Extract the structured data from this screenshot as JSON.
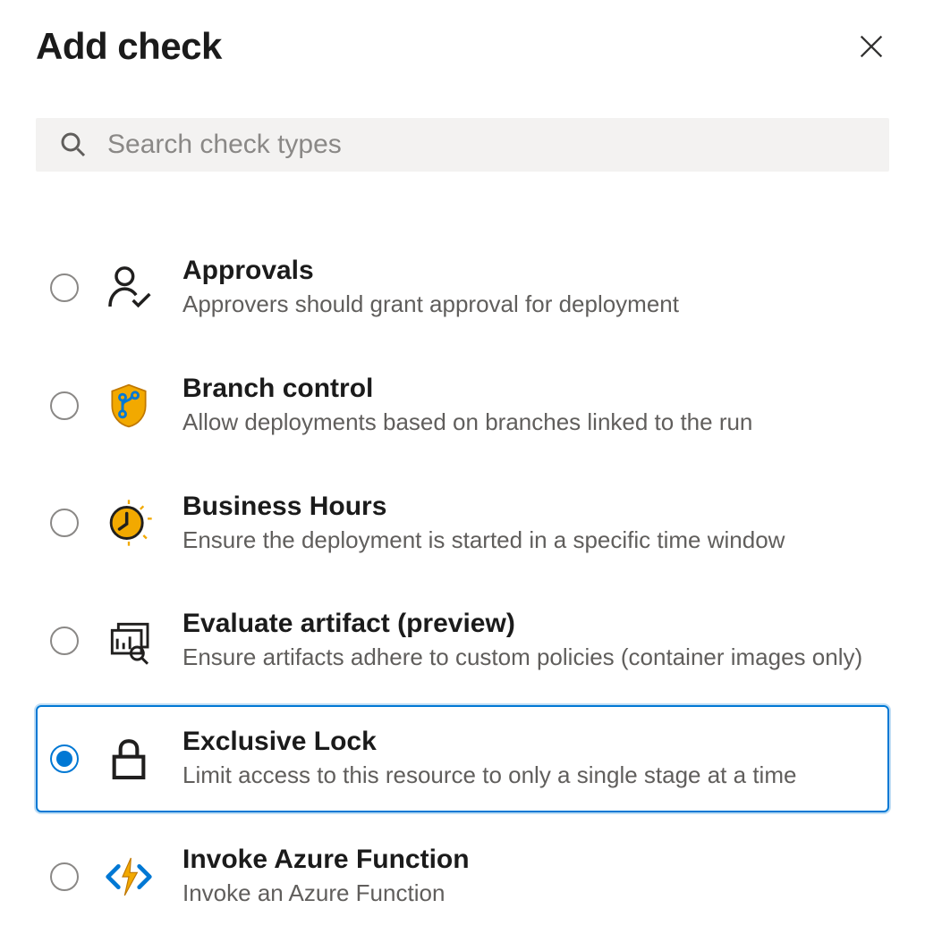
{
  "title": "Add check",
  "search": {
    "placeholder": "Search check types"
  },
  "checks": [
    {
      "id": "approvals",
      "title": "Approvals",
      "description": "Approvers should grant approval for deployment",
      "icon": "person-check",
      "selected": false
    },
    {
      "id": "branch-control",
      "title": "Branch control",
      "description": "Allow deployments based on branches linked to the run",
      "icon": "branch-shield",
      "selected": false
    },
    {
      "id": "business-hours",
      "title": "Business Hours",
      "description": "Ensure the deployment is started in a specific time window",
      "icon": "clock",
      "selected": false
    },
    {
      "id": "evaluate-artifact",
      "title": "Evaluate artifact (preview)",
      "description": "Ensure artifacts adhere to custom policies (container images only)",
      "icon": "artifact",
      "selected": false
    },
    {
      "id": "exclusive-lock",
      "title": "Exclusive Lock",
      "description": "Limit access to this resource to only a single stage at a time",
      "icon": "lock",
      "selected": true
    },
    {
      "id": "invoke-azure-function",
      "title": "Invoke Azure Function",
      "description": "Invoke an Azure Function",
      "icon": "azure-function",
      "selected": false
    }
  ]
}
